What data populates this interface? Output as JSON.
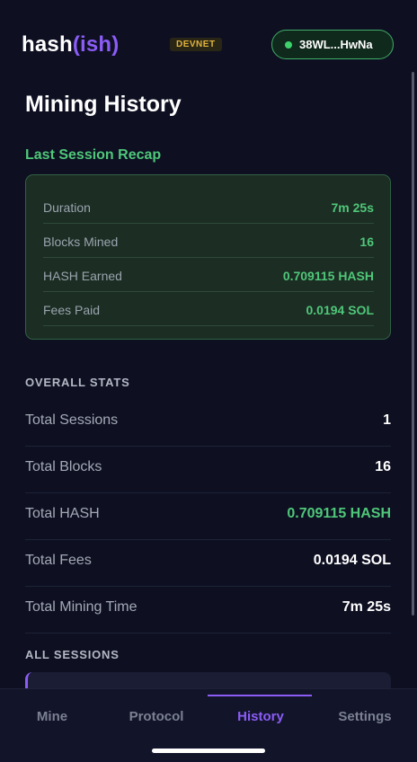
{
  "app": {
    "logo_main": "hash",
    "logo_accent": "(ish)",
    "network_badge": "DEVNET",
    "wallet_address": "38WL...HwNa"
  },
  "page": {
    "title": "Mining History"
  },
  "recap": {
    "title": "Last Session Recap",
    "rows": [
      {
        "label": "Duration",
        "value": "7m 25s"
      },
      {
        "label": "Blocks Mined",
        "value": "16"
      },
      {
        "label": "HASH Earned",
        "value": "0.709115 HASH"
      },
      {
        "label": "Fees Paid",
        "value": "0.0194 SOL"
      }
    ]
  },
  "overall": {
    "title": "OVERALL STATS",
    "rows": [
      {
        "label": "Total Sessions",
        "value": "1"
      },
      {
        "label": "Total Blocks",
        "value": "16"
      },
      {
        "label": "Total HASH",
        "value": "0.709115 HASH"
      },
      {
        "label": "Total Fees",
        "value": "0.0194 SOL"
      },
      {
        "label": "Total Mining Time",
        "value": "7m 25s"
      }
    ]
  },
  "sessions": {
    "title": "ALL SESSIONS"
  },
  "tabs": [
    {
      "label": "Mine"
    },
    {
      "label": "Protocol"
    },
    {
      "label": "History"
    },
    {
      "label": "Settings"
    }
  ],
  "colors": {
    "background": "#0e1022",
    "accent_purple": "#8b5cf6",
    "accent_green": "#4fc779",
    "badge_yellow": "#e0b43c"
  },
  "icons": {
    "wallet_status": "status-dot-icon"
  }
}
